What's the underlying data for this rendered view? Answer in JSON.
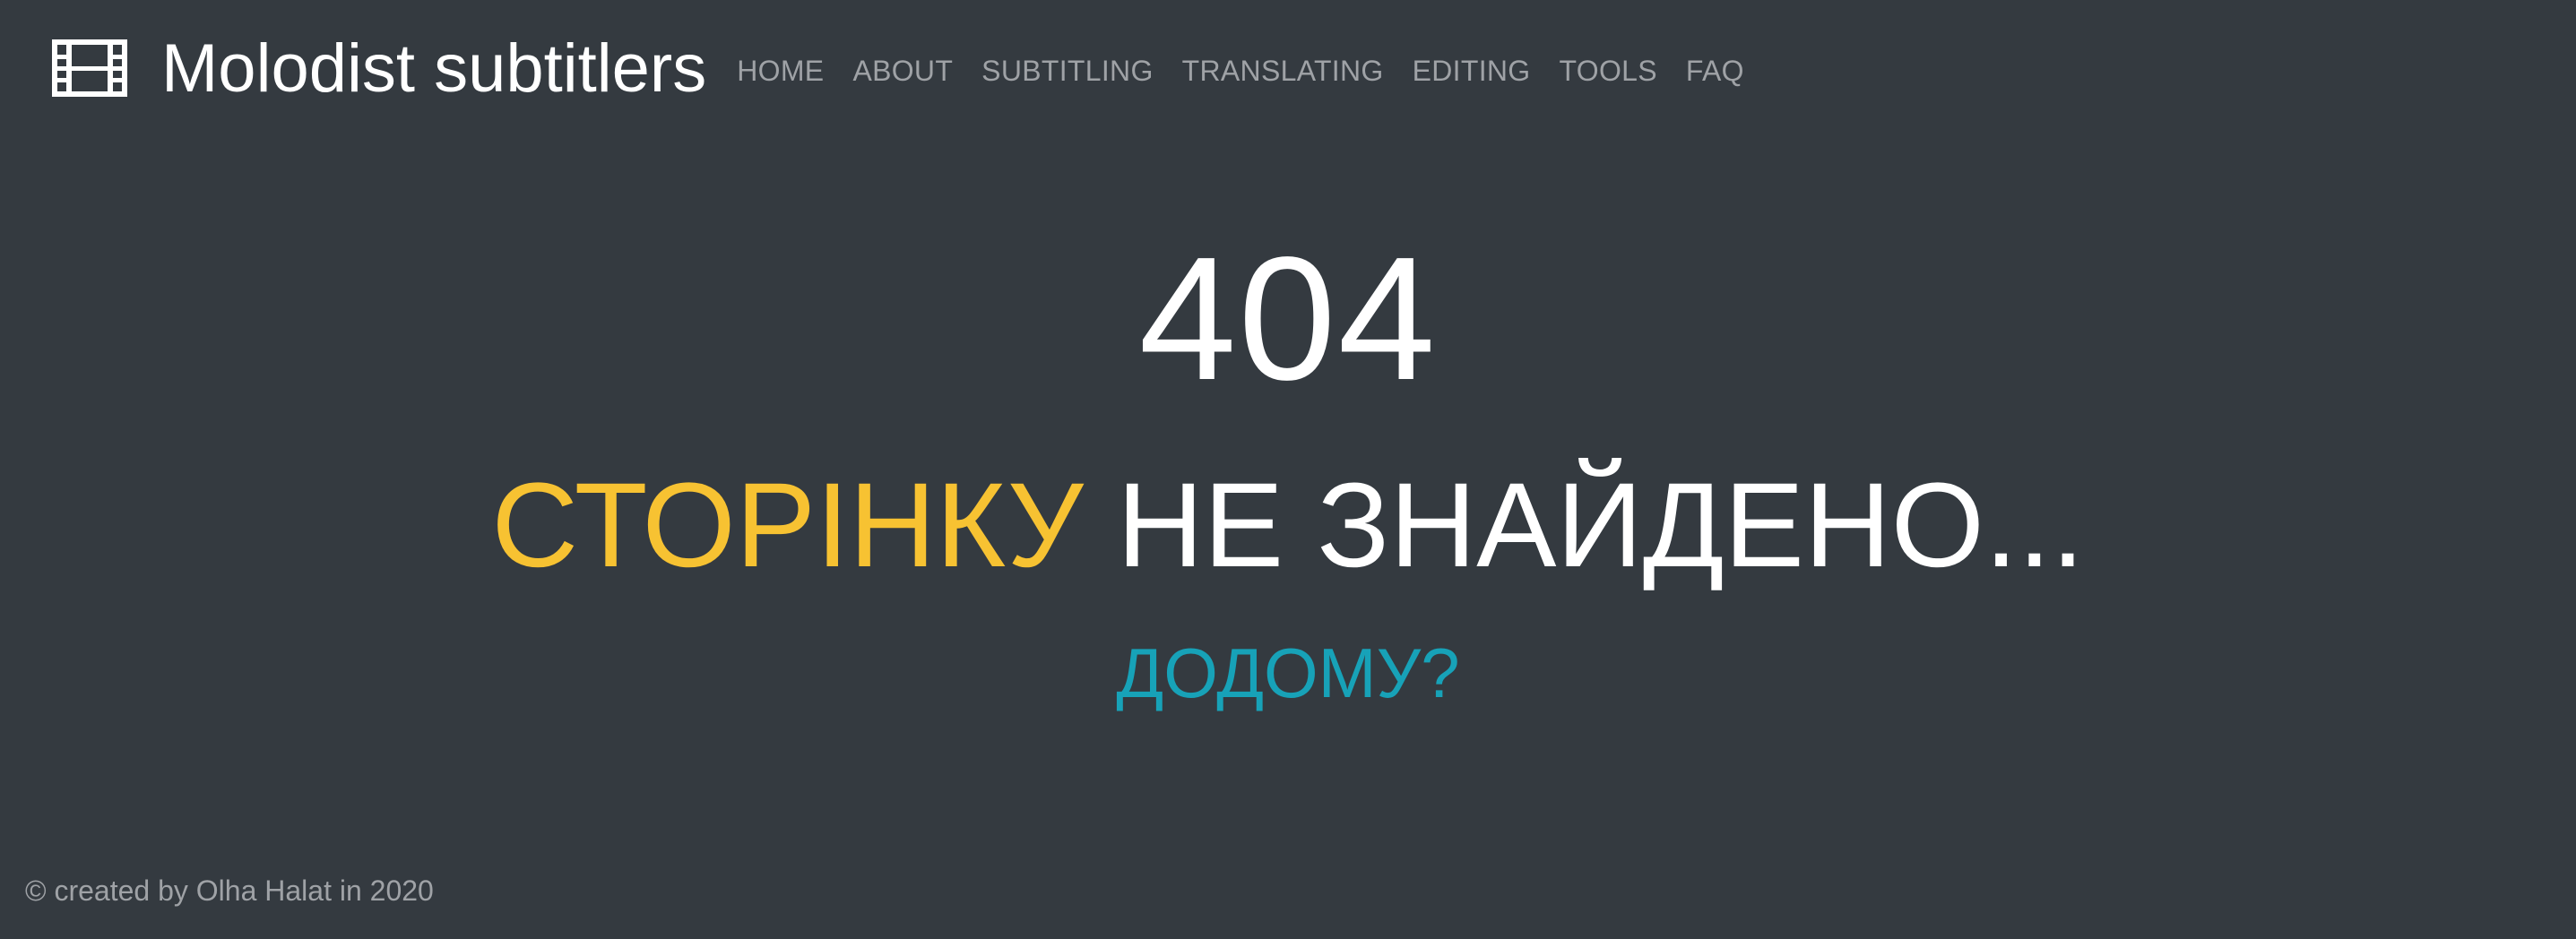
{
  "navbar": {
    "brand_icon": "film-icon",
    "brand_text": "Molodist subtitlers",
    "links": [
      {
        "label": "HOME"
      },
      {
        "label": "ABOUT"
      },
      {
        "label": "SUBTITLING"
      },
      {
        "label": "TRANSLATING"
      },
      {
        "label": "EDITING"
      },
      {
        "label": "TOOLS"
      },
      {
        "label": "FAQ"
      }
    ]
  },
  "main": {
    "code": "404",
    "message_accent": "СТОРІНКУ",
    "message_rest": "НЕ ЗНАЙДЕНО...",
    "home_link": "ДОДОМУ?"
  },
  "footer": {
    "text": "© created by Olha Halat in 2020"
  },
  "colors": {
    "background": "#343a40",
    "accent_yellow": "#f7c232",
    "link_teal": "#17a2b8",
    "nav_gray": "#9fa2a6"
  }
}
